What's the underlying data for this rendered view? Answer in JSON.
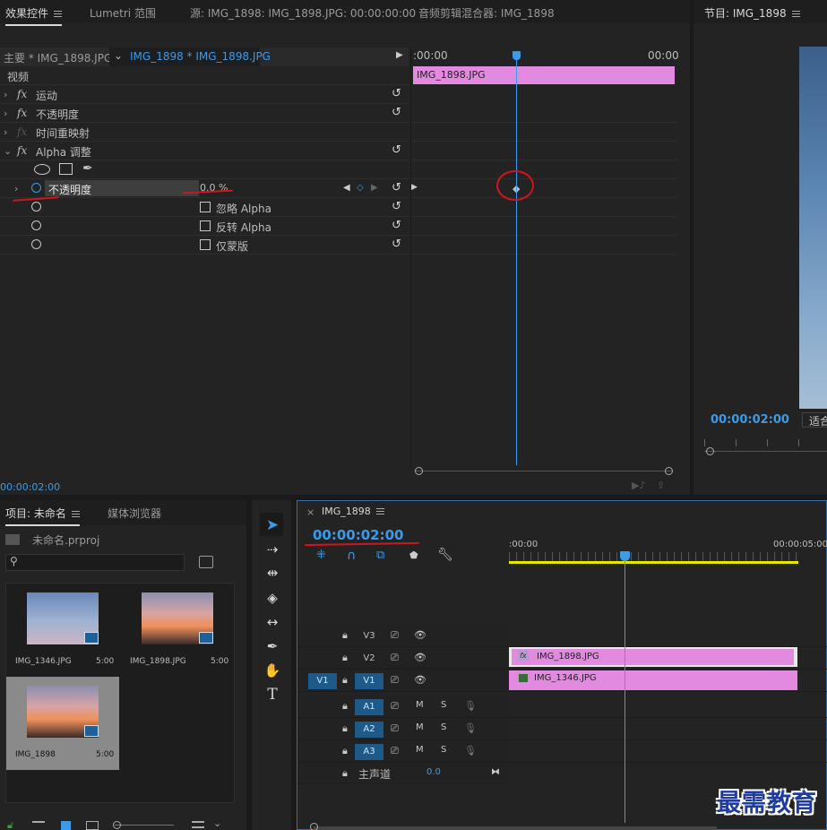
{
  "effects_panel": {
    "tabs": [
      "效果控件",
      "Lumetri 范围",
      "源: IMG_1898: IMG_1898.JPG: 00:00:00:00",
      "音频剪辑混合器: IMG_1898"
    ],
    "master_clip": "主要 * IMG_1898.JPG",
    "sequence_clip": "IMG_1898 * IMG_1898.JPG",
    "section_video": "视频",
    "effects": [
      "运动",
      "不透明度",
      "时间重映射",
      "Alpha 调整"
    ],
    "fx_label": "fx",
    "param_opacity": "不透明度",
    "param_value": "0.0 %",
    "option_ignore_alpha": "忽略 Alpha",
    "option_invert_alpha": "反转 Alpha",
    "option_mask_only": "仅蒙版",
    "mini_timeline_start": ":00:00",
    "mini_timeline_end": "00:00",
    "mini_clip_name": "IMG_1898.JPG",
    "current_time": "00:00:02:00"
  },
  "program_monitor": {
    "title": "节目: IMG_1898",
    "timecode": "00:00:02:00",
    "fit_label": "适合"
  },
  "project_panel": {
    "tabs": [
      "项目: 未命名",
      "媒体浏览器"
    ],
    "project_file": "未命名.prproj",
    "items": [
      {
        "name": "IMG_1346.JPG",
        "duration": "5:00"
      },
      {
        "name": "IMG_1898.JPG",
        "duration": "5:00"
      },
      {
        "name": "IMG_1898",
        "duration": "5:00"
      }
    ]
  },
  "timeline": {
    "sequence_tab": "IMG_1898",
    "close_glyph": "×",
    "timecode": "00:00:02:00",
    "ruler_start": ":00:00",
    "ruler_end": "00:00:05:00",
    "video_tracks": [
      "V3",
      "V2",
      "V1"
    ],
    "source_patch": "V1",
    "audio_tracks": [
      "A1",
      "A2",
      "A3"
    ],
    "mute_label": "M",
    "solo_label": "S",
    "master_label": "主声道",
    "master_value": "0.0",
    "clip_v2": "IMG_1898.JPG",
    "clip_v1": "IMG_1346.JPG"
  },
  "watermark": "最需教育",
  "colors": {
    "accent": "#3b9be8",
    "clip": "#e28ae0",
    "work_area": "#e6e600",
    "annotation": "#d4141c"
  }
}
